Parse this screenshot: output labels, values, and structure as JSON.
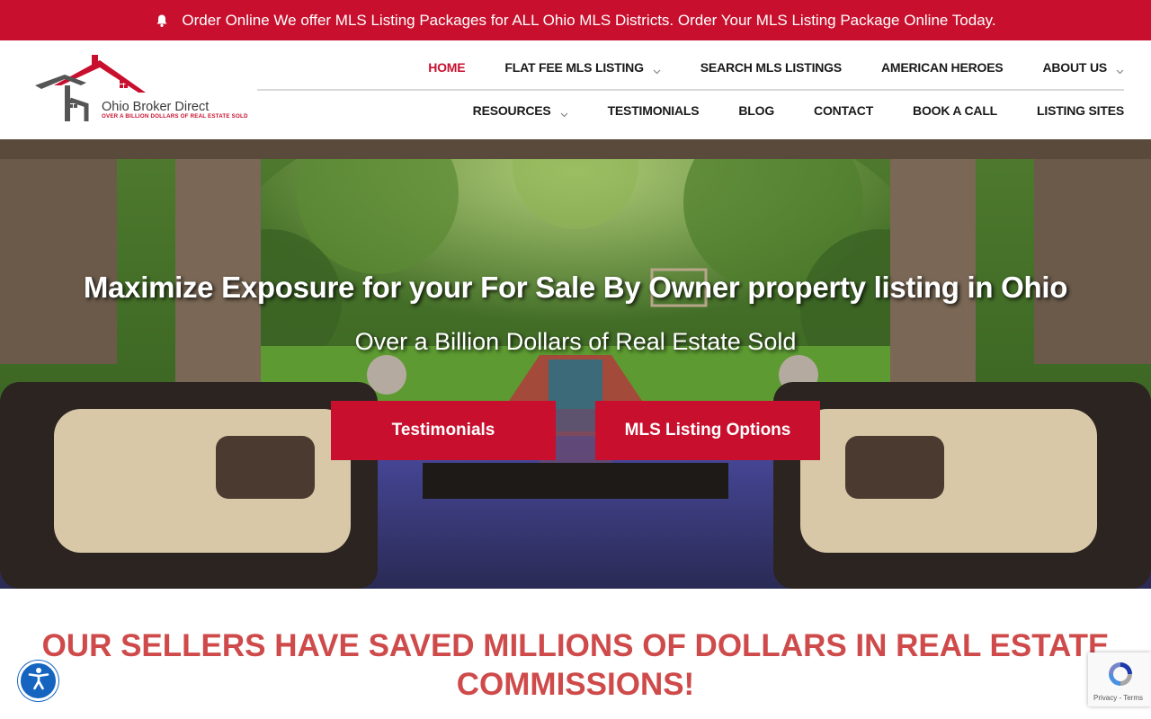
{
  "announcement": {
    "text": "Order Online We offer MLS Listing Packages for ALL Ohio MLS Districts. Order Your MLS Listing Package Online Today.",
    "icon": "bell-icon"
  },
  "logo": {
    "brand": "Ohio Broker Direct",
    "tagline": "OVER A BILLION DOLLARS OF REAL ESTATE SOLD"
  },
  "nav": {
    "row1": [
      {
        "label": "HOME",
        "active": true,
        "dropdown": false
      },
      {
        "label": "FLAT FEE MLS LISTING",
        "active": false,
        "dropdown": true
      },
      {
        "label": "SEARCH MLS LISTINGS",
        "active": false,
        "dropdown": false
      },
      {
        "label": "AMERICAN HEROES",
        "active": false,
        "dropdown": false
      },
      {
        "label": "ABOUT US",
        "active": false,
        "dropdown": true
      }
    ],
    "row2": [
      {
        "label": "RESOURCES",
        "active": false,
        "dropdown": true
      },
      {
        "label": "TESTIMONIALS",
        "active": false,
        "dropdown": false
      },
      {
        "label": "BLOG",
        "active": false,
        "dropdown": false
      },
      {
        "label": "CONTACT",
        "active": false,
        "dropdown": false
      },
      {
        "label": "BOOK A CALL",
        "active": false,
        "dropdown": false
      },
      {
        "label": "LISTING SITES",
        "active": false,
        "dropdown": false
      }
    ]
  },
  "hero": {
    "title": "Maximize Exposure for your For Sale By Owner property listing in Ohio",
    "subtitle": "Over a Billion Dollars of Real Estate Sold",
    "buttons": {
      "testimonials": "Testimonials",
      "mls_options": "MLS Listing Options"
    }
  },
  "section": {
    "headline": "OUR SELLERS HAVE SAVED MILLIONS OF DOLLARS IN REAL ESTATE COMMISSIONS!"
  },
  "recaptcha": {
    "privacy": "Privacy",
    "separator": " - ",
    "terms": "Terms"
  },
  "colors": {
    "brand_red": "#c8102e",
    "headline_red": "#cf4a4a",
    "accessibility_blue": "#1565c0"
  }
}
